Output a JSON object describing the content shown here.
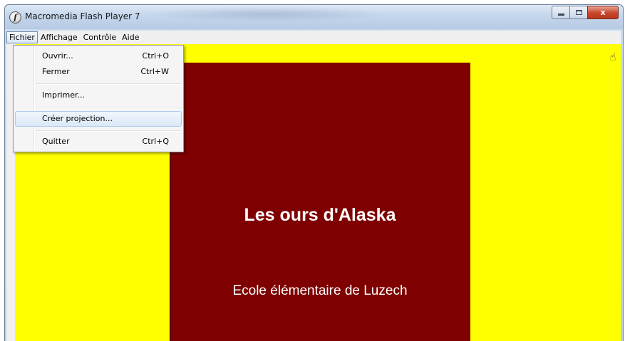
{
  "window": {
    "title": "Macromedia Flash Player 7",
    "app_icon_glyph": "f",
    "controls": {
      "minimize": "",
      "maximize": "",
      "close": "x"
    }
  },
  "menubar": {
    "items": [
      {
        "label": "Fichier",
        "open": true
      },
      {
        "label": "Affichage"
      },
      {
        "label": "Contrôle"
      },
      {
        "label": "Aide"
      }
    ]
  },
  "file_menu": {
    "items": [
      {
        "label": "Ouvrir...",
        "shortcut": "Ctrl+O"
      },
      {
        "label": "Fermer",
        "shortcut": "Ctrl+W"
      },
      {
        "label": "Imprimer...",
        "shortcut": ""
      },
      {
        "label": "Créer projection...",
        "shortcut": "",
        "highlighted": true
      },
      {
        "label": "Quitter",
        "shortcut": "Ctrl+Q"
      }
    ]
  },
  "content": {
    "title": "Les ours d'Alaska",
    "subtitle": "Ecole élémentaire de Luzech",
    "background_color": "#ffff00",
    "card_color": "#7e0000",
    "hand_icon": "hand-pointer-icon"
  }
}
